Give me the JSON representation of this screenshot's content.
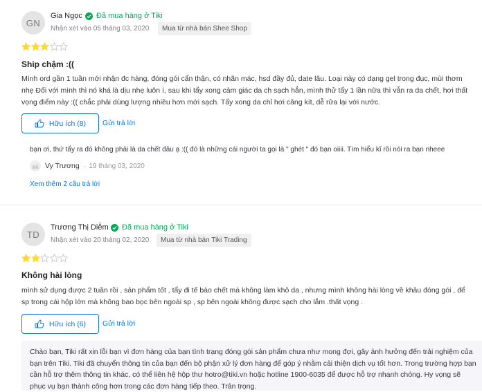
{
  "reviews": [
    {
      "initials": "GN",
      "name": "Gia Ngọc",
      "verified": "Đã mua hàng ở Tiki",
      "date": "Nhận xét vào 05 tháng 03, 2020",
      "shop": "Mua từ nhà bán Shee Shop",
      "rating": 3,
      "max_rating": 5,
      "title": "Ship chậm :((",
      "body": "Mình ord gần 1 tuần mới nhận đc hàng, đóng gói cẩn thận, có nhãn mác, hsd đầy đủ, date lâu. Loại này có dạng gel trong đục, mùi thơm nhẹ Đối với mình thì nó khá là dịu nhẹ luôn í, sau khi tẩy xong cảm giác da ch sạch hẳn, mình thử tẩy 1 lần nữa thì vẫn ra da chết, hơi thất vọng điểm này :(( chắc phải dùng lượng nhiều hơn mới sạch. Tẩy xong da chỉ hơi căng kít, dễ rửa lại với nước.",
      "helpful": "Hữu ích (8)",
      "reply": "Gửi trả lời",
      "comment": {
        "text": "bạn ơi, thứ tẩy ra đó không phải là da chết đâu ạ :(( đó là những cái người ta gọi là \" ghét \" đó bạn oiiii. Tìm hiểu kĩ rồi nói ra bạn nheee",
        "author": "Vy Trương",
        "separator": "·",
        "date": "19 tháng 03, 2020"
      },
      "see_more": "Xem thêm 2 câu trả lời"
    },
    {
      "initials": "TD",
      "name": "Trương Thị Diễm",
      "verified": "Đã mua hàng ở Tiki",
      "date": "Nhận xét vào 20 tháng 02, 2020",
      "shop": "Mua từ nhà bán Tiki Trading",
      "rating": 2,
      "max_rating": 5,
      "title": "Không hài lòng",
      "body": "mình sử dụng được 2 tuần rồi , sản phẩm tốt , tẩy đi tế bào chết mà không làm khô da , nhưng mình không hài lòng về khâu đóng gói , để sp trong cái hộp lớn mà không bao bọc bên ngoài sp , sp bên ngoài không được sạch cho lắm .thất vọng .",
      "helpful": "Hữu ích (6)",
      "reply": "Gửi trả lời",
      "seller_reply": "Chào bạn, Tiki rất xin lỗi bạn vì đơn hàng của bạn tình trạng đóng gói sản phẩm chưa như mong đợi, gây ảnh hưởng đến trải nghiệm của bạn trên Tiki. Tiki đã chuyển thông tin của bạn đến bộ phận xử lý đơn hàng để góp ý nhằm cải thiện dịch vụ tốt hơn. Trong trường hợp bạn cần hỗ trợ thêm thông tin khác, có thể liên hệ hộp thư hotro@tiki.vn hoặc hotline 1900-6035 để được hỗ trợ nhanh chóng. Hy vọng sẽ phục vụ bạn thành công hơn trong các đơn hàng tiếp theo. Trân trọng."
    }
  ],
  "colors": {
    "star": "#fdd836",
    "star_empty": "#c7c7c7",
    "verified": "#00ab56",
    "link": "#0b74e5"
  }
}
